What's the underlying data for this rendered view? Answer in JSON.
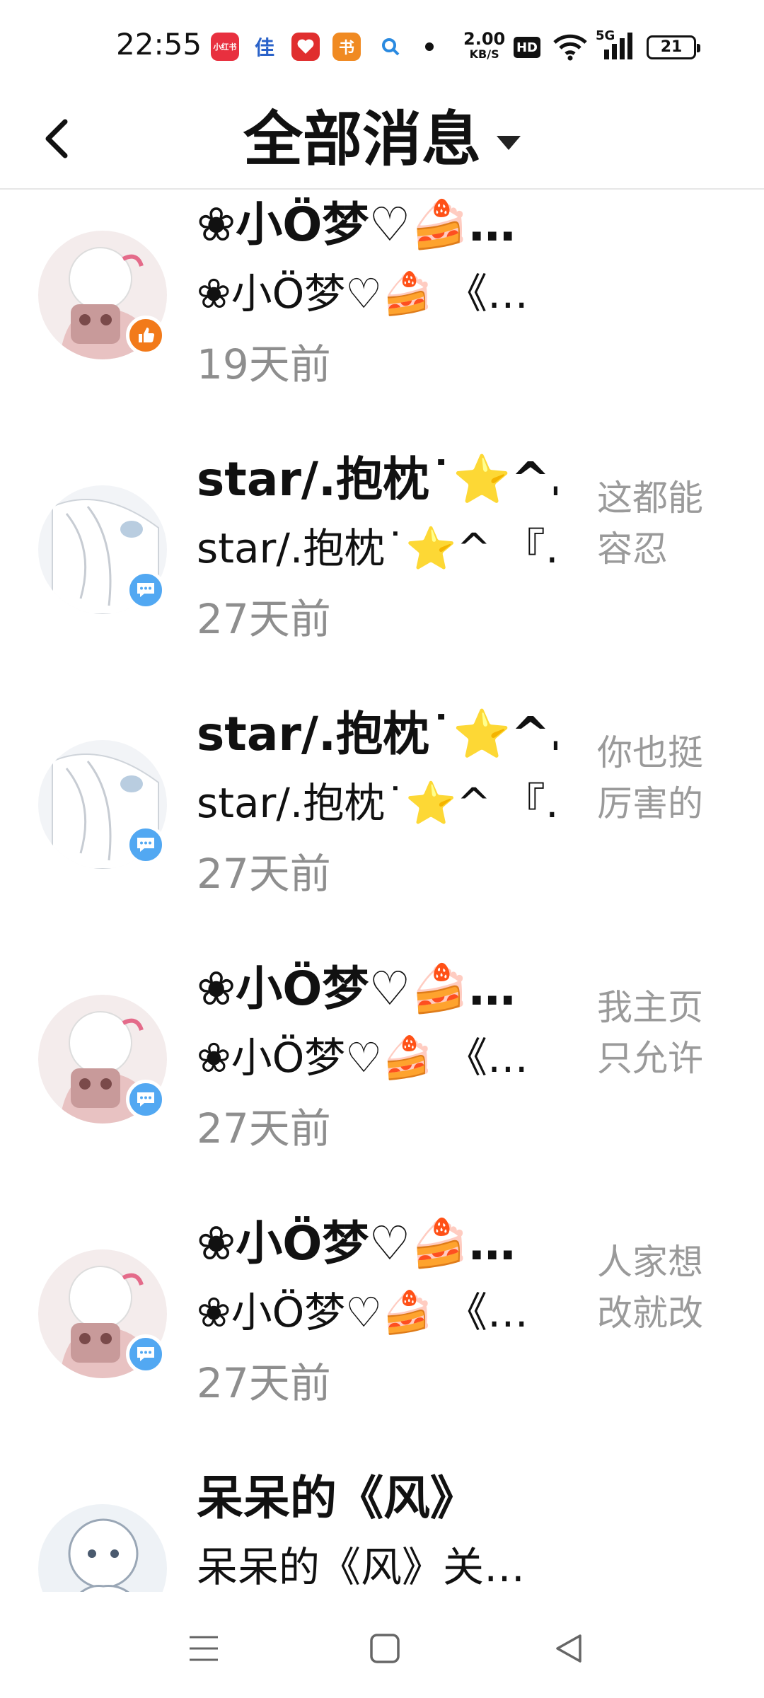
{
  "status_bar": {
    "time": "22:55",
    "app_icons": [
      {
        "icon": "xiaohongshu-app-icon",
        "label": "小红书",
        "color": "#e8303f"
      },
      {
        "icon": "jiazhuang-app-icon",
        "label": "佳",
        "color": "#ffffff"
      },
      {
        "icon": "heart-app-icon",
        "label": "",
        "color": "#e02e2e"
      },
      {
        "icon": "shop-app-icon",
        "label": "书",
        "color": "#f08a22"
      },
      {
        "icon": "search-app-icon",
        "label": "",
        "color": "#ffffff"
      }
    ],
    "net_speed_value": "2.00",
    "net_speed_unit": "KB/S",
    "hd_label": "HD",
    "network_label": "5G",
    "battery": "21"
  },
  "header": {
    "title": "全部消息",
    "back_icon": "chevron-left-icon",
    "dropdown_icon": "caret-down-icon"
  },
  "messages": [
    {
      "name": "❀小Ö梦♡🍰…",
      "preview": "❀小Ö梦♡🍰 《…",
      "time": "19天前",
      "quote": "",
      "badge": "like"
    },
    {
      "name": "star/.抱枕˙⭐^…",
      "preview": "star/.抱枕˙⭐^ 『…",
      "time": "27天前",
      "quote": "这都能容忍",
      "badge": "comment"
    },
    {
      "name": "star/.抱枕˙⭐^…",
      "preview": "star/.抱枕˙⭐^ 『…",
      "time": "27天前",
      "quote": "你也挺厉害的",
      "badge": "comment"
    },
    {
      "name": "❀小Ö梦♡🍰…",
      "preview": "❀小Ö梦♡🍰 《…",
      "time": "27天前",
      "quote": "我主页只允许姿斗",
      "badge": "comment"
    },
    {
      "name": "❀小Ö梦♡🍰…",
      "preview": "❀小Ö梦♡🍰 《…",
      "time": "27天前",
      "quote": "人家想改就改",
      "badge": "comment"
    },
    {
      "name": "呆呆的《风》",
      "preview": "呆呆的《风》关…",
      "time": "",
      "quote": "",
      "badge": ""
    }
  ],
  "nav": {
    "menu_icon": "menu-icon",
    "home_icon": "home-square-icon",
    "back_icon": "back-triangle-icon"
  },
  "colors": {
    "accent_like": "#f27a1a",
    "accent_comment": "#52a8f2",
    "muted_text": "#8e8e8e"
  }
}
